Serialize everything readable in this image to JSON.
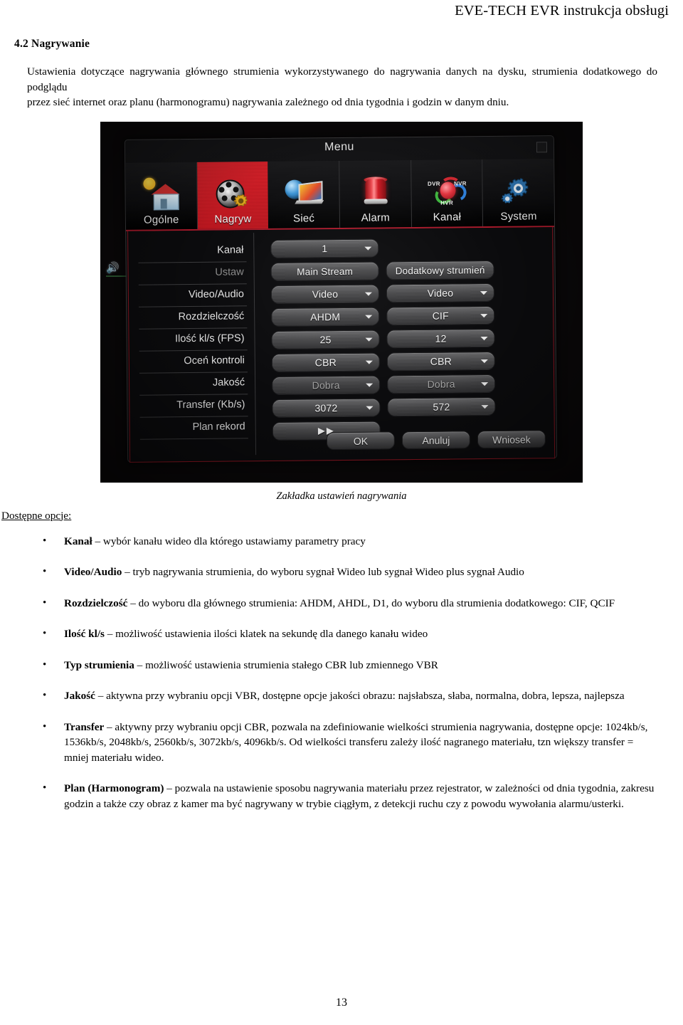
{
  "document": {
    "running_header": "EVE-TECH EVR instrukcja obsługi",
    "section_number_title": "4.2 Nagrywanie",
    "intro_line1": "Ustawienia dotyczące nagrywania głównego strumienia wykorzystywanego do nagrywania danych na dysku, strumienia dodatkowego do podglądu",
    "intro_line2": "przez sieć internet oraz planu (harmonogramu) nagrywania zależnego od dnia tygodnia i godzin w danym dniu.",
    "figure_caption": "Zakładka ustawień nagrywania",
    "options_label": "Dostępne opcje:",
    "page_number": "13"
  },
  "evr": {
    "window_title": "Menu",
    "close_icon": "close-icon",
    "tabs": [
      {
        "label": "Ogólne",
        "icon": "house-sun-icon",
        "active": false
      },
      {
        "label": "Nagryw",
        "icon": "film-reel-gear-icon",
        "active": true
      },
      {
        "label": "Sieć",
        "icon": "globe-monitor-icon",
        "active": false
      },
      {
        "label": "Alarm",
        "icon": "siren-icon",
        "active": false
      },
      {
        "label": "Kanał",
        "icon": "dvr-nvr-hvr-icon",
        "active": false
      },
      {
        "label": "System",
        "icon": "gear-icon",
        "active": false
      }
    ],
    "channel_icon_texts": {
      "dvr": "DVR",
      "nvr": "NVR",
      "hvr": "HVR"
    },
    "row_labels": [
      {
        "text": "Kanał",
        "dim": false
      },
      {
        "text": "Ustaw",
        "dim": true
      },
      {
        "text": "Video/Audio",
        "dim": false
      },
      {
        "text": "Rozdzielczość",
        "dim": false
      },
      {
        "text": "Ilość kl/s (FPS)",
        "dim": false
      },
      {
        "text": "Oceń kontroli",
        "dim": false
      },
      {
        "text": "Jakość",
        "dim": false
      },
      {
        "text": "Transfer (Kb/s)",
        "dim": false
      },
      {
        "text": "Plan rekord",
        "dim": false
      }
    ],
    "main_stream": {
      "channel": "1",
      "stream_header": "Main Stream",
      "video_audio": "Video",
      "resolution": "AHDM",
      "fps": "25",
      "rate_control": "CBR",
      "quality": "Dobra",
      "bitrate": "3072",
      "plan": "▶▶"
    },
    "sub_stream": {
      "stream_header": "Dodatkowy strumień",
      "video_audio": "Video",
      "resolution": "CIF",
      "fps": "12",
      "rate_control": "CBR",
      "quality": "Dobra",
      "bitrate": "572"
    },
    "buttons": {
      "ok": "OK",
      "cancel": "Anuluj",
      "apply": "Wniosek"
    },
    "accent_red": "#d41f28",
    "border_red": "#8e1420"
  },
  "options": [
    {
      "term": "Kanał",
      "desc": " – wybór kanału wideo dla którego ustawiamy parametry pracy"
    },
    {
      "term": "Video/Audio",
      "desc": " – tryb nagrywania strumienia, do wyboru sygnał Wideo lub sygnał Wideo plus sygnał Audio"
    },
    {
      "term": "Rozdzielczość",
      "desc": " – do wyboru dla głównego strumienia: AHDM, AHDL, D1, do wyboru dla strumienia dodatkowego: CIF, QCIF"
    },
    {
      "term": "Ilość kl/s",
      "desc": " – możliwość ustawienia ilości klatek na sekundę dla danego kanału wideo"
    },
    {
      "term": "Typ strumienia",
      "desc": " – możliwość ustawienia strumienia stałego CBR lub zmiennego VBR"
    },
    {
      "term": "Jakość",
      "desc": " – aktywna przy wybraniu opcji VBR, dostępne opcje jakości obrazu: najsłabsza, słaba, normalna, dobra, lepsza, najlepsza"
    },
    {
      "term": "Transfer",
      "desc": " – aktywny przy wybraniu opcji CBR, pozwala na zdefiniowanie wielkości strumienia nagrywania, dostępne opcje: 1024kb/s, 1536kb/s, 2048kb/s, 2560kb/s, 3072kb/s, 4096kb/s. Od wielkości transferu zależy ilość nagranego materiału, tzn większy transfer = mniej materiału wideo."
    },
    {
      "term": "Plan (Harmonogram)",
      "desc": " – pozwala na ustawienie sposobu nagrywania materiału przez rejestrator, w zależności od dnia tygodnia, zakresu godzin a także czy obraz z kamer ma być nagrywany w trybie ciągłym, z detekcji ruchu czy z powodu wywołania alarmu/usterki."
    }
  ],
  "bullet_glyph": "•"
}
